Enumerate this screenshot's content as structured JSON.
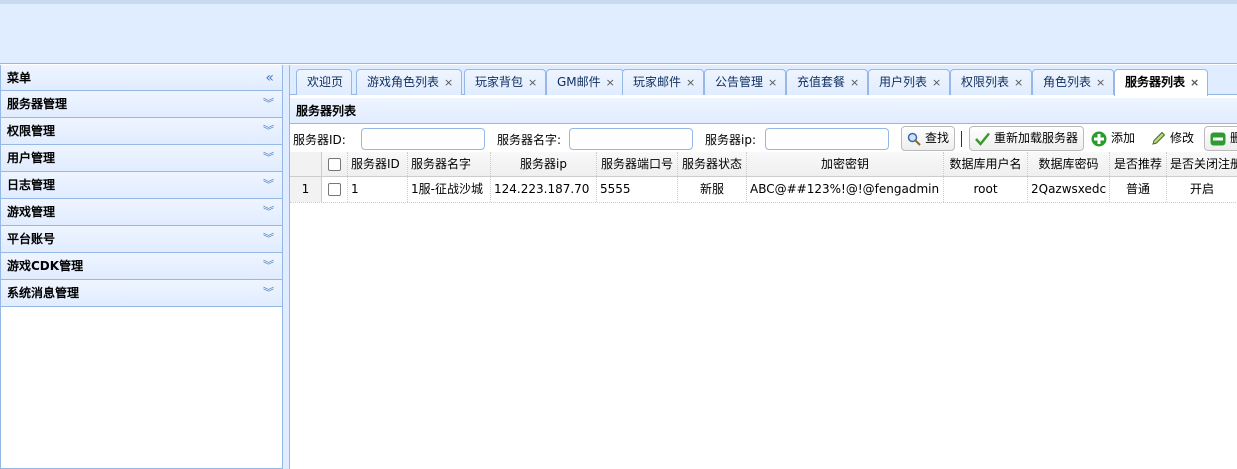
{
  "sidebar": {
    "title": "菜单",
    "items": [
      {
        "label": "服务器管理"
      },
      {
        "label": "权限管理"
      },
      {
        "label": "用户管理"
      },
      {
        "label": "日志管理"
      },
      {
        "label": "游戏管理"
      },
      {
        "label": "平台账号"
      },
      {
        "label": "游戏CDK管理"
      },
      {
        "label": "系统消息管理"
      }
    ]
  },
  "tabs": [
    {
      "label": "欢迎页",
      "closable": false
    },
    {
      "label": "游戏角色列表",
      "closable": true
    },
    {
      "label": "玩家背包",
      "closable": true
    },
    {
      "label": "GM邮件",
      "closable": true
    },
    {
      "label": "玩家邮件",
      "closable": true
    },
    {
      "label": "公告管理",
      "closable": true
    },
    {
      "label": "充值套餐",
      "closable": true
    },
    {
      "label": "用户列表",
      "closable": true
    },
    {
      "label": "权限列表",
      "closable": true
    },
    {
      "label": "角色列表",
      "closable": true
    },
    {
      "label": "服务器列表",
      "closable": true,
      "active": true
    }
  ],
  "close_glyph": "×",
  "panel": {
    "title": "服务器列表"
  },
  "toolbar": {
    "server_id_label": "服务器ID:",
    "server_name_label": "服务器名字:",
    "server_ip_label": "服务器ip:",
    "search_label": "查找",
    "reload_label": "重新加载服务器",
    "add_label": "添加",
    "edit_label": "修改",
    "delete_label": "删"
  },
  "table": {
    "columns": [
      "服务器ID",
      "服务器名字",
      "服务器ip",
      "服务器端口号",
      "服务器状态",
      "加密密钥",
      "数据库用户名",
      "数据库密码",
      "是否推荐",
      "是否关闭注册"
    ],
    "rows": [
      {
        "num": "1",
        "cells": [
          "1",
          "1服-征战沙城",
          "124.223.187.70",
          "5555",
          "新服",
          "ABC@##123%!@!@fengadmin",
          "root",
          "2Qazwsxedc",
          "普通",
          "开启"
        ]
      }
    ]
  },
  "colors": {
    "accent": "#95b8e7",
    "header_bg": "#e0ecff",
    "add_icon": "#2e9b2e",
    "delete_icon": "#2e9b2e"
  }
}
